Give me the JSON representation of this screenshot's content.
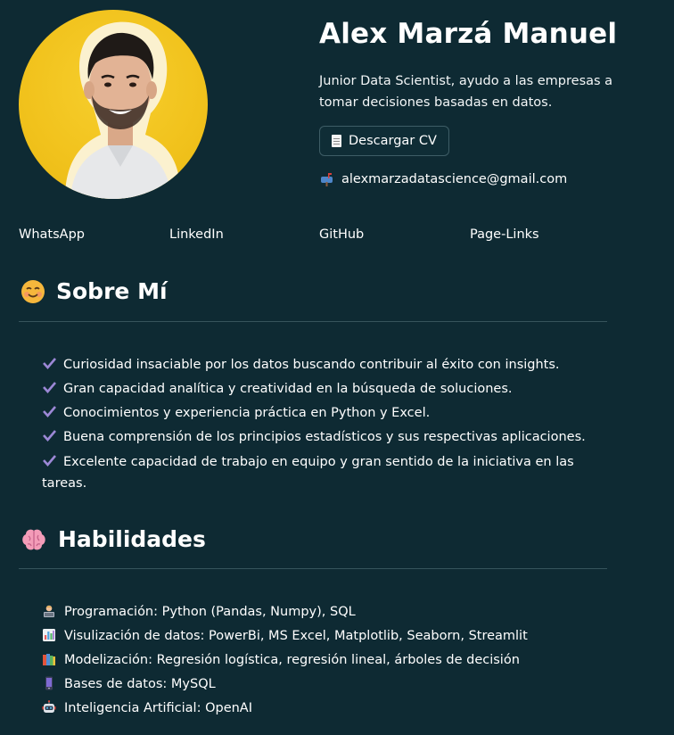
{
  "profile": {
    "name": "Alex Marzá Manuel",
    "tagline": "Junior Data Scientist, ayudo a las empresas a tomar decisiones basadas en datos.",
    "cv_button_label": "Descargar CV",
    "email": "alexmarzadatascience@gmail.com"
  },
  "links": {
    "whatsapp": "WhatsApp",
    "linkedin": "LinkedIn",
    "github": "GitHub",
    "page_links": "Page-Links"
  },
  "about": {
    "title": "Sobre Mí",
    "icon": "smiling-face-icon",
    "items": [
      "Curiosidad insaciable por los datos buscando contribuir al éxito con insights.",
      "Gran capacidad analítica y creatividad en la búsqueda de soluciones.",
      "Conocimientos y experiencia práctica en Python y Excel.",
      "Buena comprensión de los principios estadísticos y sus respectivas aplicaciones.",
      "Excelente capacidad de trabajo en equipo y gran sentido de la iniciativa en las tareas."
    ]
  },
  "skills": {
    "title": "Habilidades",
    "icon": "brain-icon",
    "items": [
      "Programación: Python (Pandas, Numpy), SQL",
      "Visulización de datos: PowerBi, MS Excel, Matplotlib, Seaborn, Streamlit",
      "Modelización: Regresión logística, regresión lineal, árboles de decisión",
      "Bases de datos: MySQL",
      "Inteligencia Artificial: OpenAI"
    ]
  },
  "colors": {
    "background": "#0e2a33",
    "text": "#ffffff",
    "divider": "#36545c",
    "avatar_bg": "#f1c21c",
    "check": "#9c88d6"
  }
}
